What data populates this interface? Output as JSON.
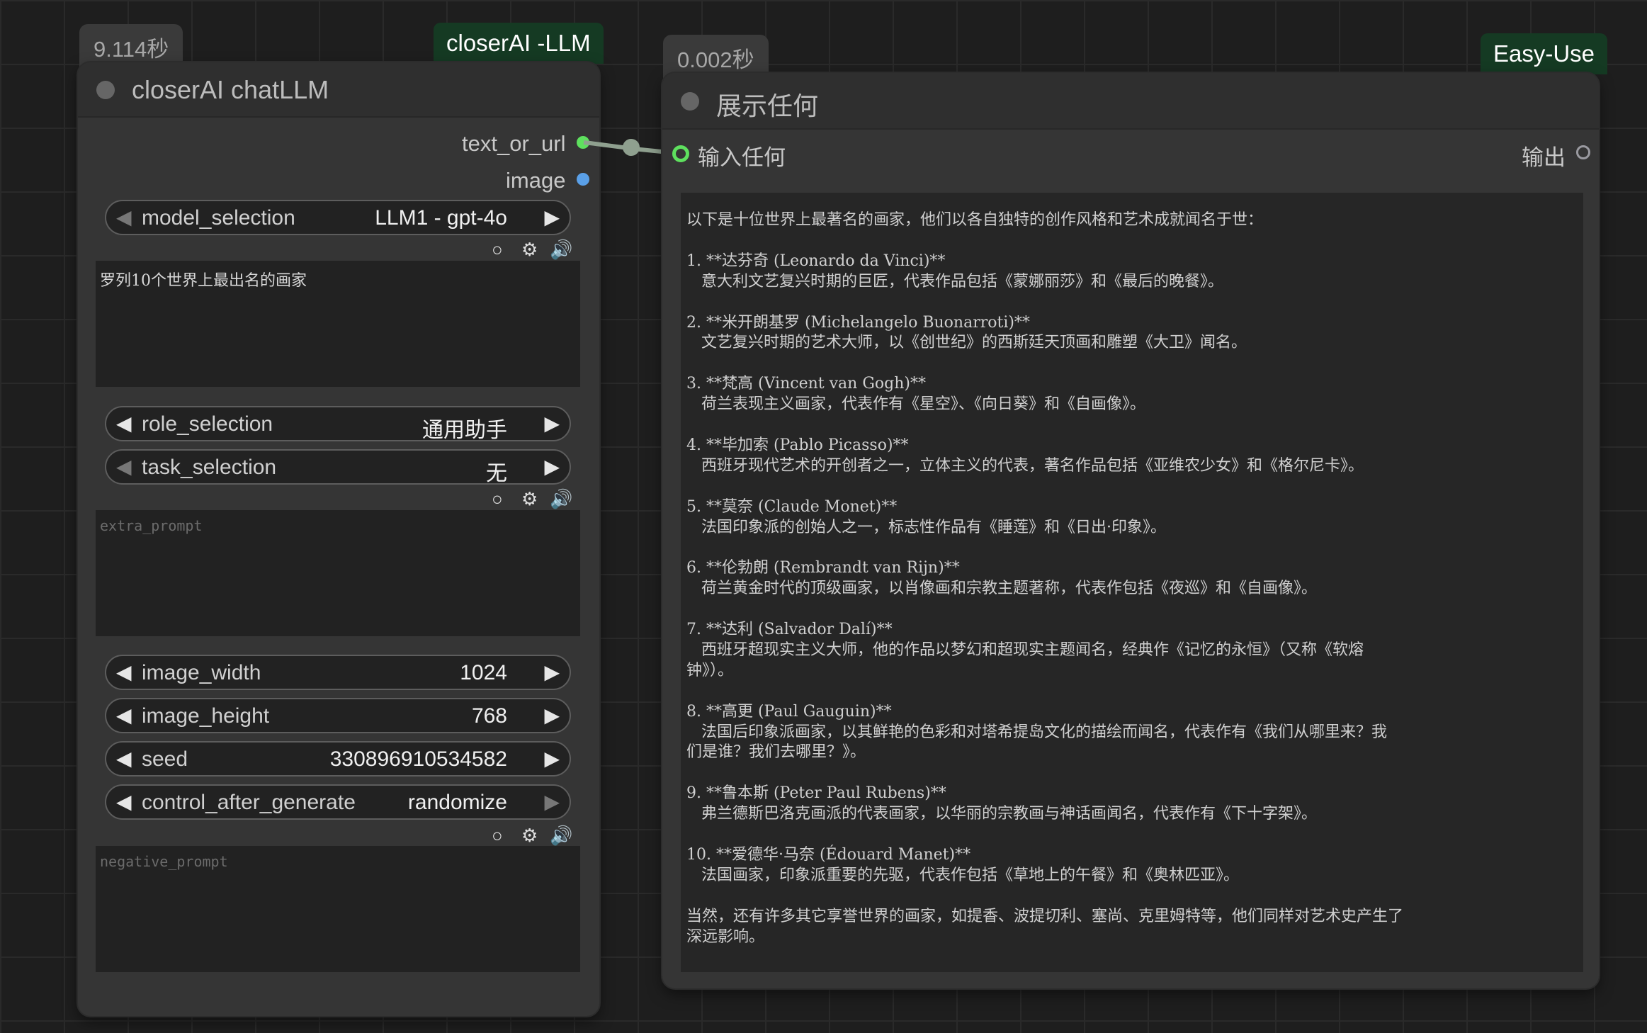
{
  "left_node": {
    "time_label": "9.114秒",
    "group_badge": "closerAI -LLM",
    "title": "closerAI chatLLM",
    "outputs": [
      {
        "label": "text_or_url",
        "color": "#5ee05e"
      },
      {
        "label": "image",
        "color": "#5aa0e8"
      }
    ],
    "model_selection": {
      "name": "model_selection",
      "value": "LLM1 - gpt-4o"
    },
    "prompt_text": "罗列10个世界上最出名的画家",
    "role_selection": {
      "name": "role_selection",
      "value": "通用助手"
    },
    "task_selection": {
      "name": "task_selection",
      "value": "无"
    },
    "extra_prompt_placeholder": "extra_prompt",
    "image_width": {
      "name": "image_width",
      "value": "1024"
    },
    "image_height": {
      "name": "image_height",
      "value": "768"
    },
    "seed": {
      "name": "seed",
      "value": "330896910534582"
    },
    "control_after_generate": {
      "name": "control_after_generate",
      "value": "randomize"
    },
    "negative_prompt_placeholder": "negative_prompt",
    "icon_row": [
      "circle-icon",
      "gear-icon",
      "speaker-icon"
    ]
  },
  "right_node": {
    "time_label": "0.002秒",
    "group_badge": "Easy-Use",
    "title": "展示任何",
    "input_label": "输入任何",
    "output_label": "输出",
    "output_lines": [
      "以下是十位世界上最著名的画家，他们以各自独特的创作风格和艺术成就闻名于世：",
      "",
      "1. **达芬奇 (Leonardo da Vinci)**",
      "   意大利文艺复兴时期的巨匠，代表作品包括《蒙娜丽莎》和《最后的晚餐》。",
      "",
      "2. **米开朗基罗 (Michelangelo Buonarroti)**",
      "   文艺复兴时期的艺术大师，以《创世纪》的西斯廷天顶画和雕塑《大卫》闻名。",
      "",
      "3. **梵高 (Vincent van Gogh)**",
      "   荷兰表现主义画家，代表作有《星空》、《向日葵》和《自画像》。",
      "",
      "4. **毕加索 (Pablo Picasso)**",
      "   西班牙现代艺术的开创者之一，立体主义的代表，著名作品包括《亚维农少女》和《格尔尼卡》。",
      "",
      "5. **莫奈 (Claude Monet)**",
      "   法国印象派的创始人之一，标志性作品有《睡莲》和《日出·印象》。",
      "",
      "6. **伦勃朗 (Rembrandt van Rijn)**",
      "   荷兰黄金时代的顶级画家，以肖像画和宗教主题著称，代表作包括《夜巡》和《自画像》。",
      "",
      "7. **达利 (Salvador Dalí)**",
      "   西班牙超现实主义大师，他的作品以梦幻和超现实主题闻名，经典作《记忆的永恒》（又称《软熔",
      "钟》）。",
      "",
      "8. **高更 (Paul Gauguin)**",
      "   法国后印象派画家，以其鲜艳的色彩和对塔希提岛文化的描绘而闻名，代表作有《我们从哪里来？我",
      "们是谁？我们去哪里？》。",
      "",
      "9. **鲁本斯 (Peter Paul Rubens)**",
      "   弗兰德斯巴洛克画派的代表画家，以华丽的宗教画与神话画闻名，代表作有《下十字架》。",
      "",
      "10. **爱德华·马奈 (Édouard Manet)**",
      "   法国画家，印象派重要的先驱，代表作包括《草地上的午餐》和《奥林匹亚》。",
      "",
      "当然，还有许多其它享誉世界的画家，如提香、波提切利、塞尚、克里姆特等，他们同样对艺术史产生了",
      "深远影响。"
    ]
  },
  "link_color": "#8fa08f"
}
